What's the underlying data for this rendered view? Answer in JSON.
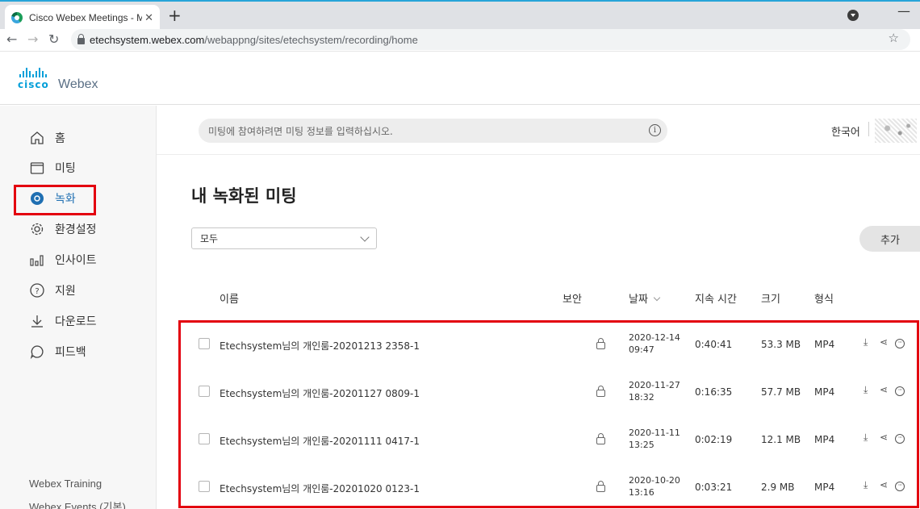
{
  "browser": {
    "tab_title": "Cisco Webex Meetings - My Re",
    "tab_close": "✕",
    "new_tab": "+",
    "window_min": "—",
    "url_host": "etechsystem.webex.com",
    "url_path": "/webappng/sites/etechsystem/recording/home"
  },
  "brand": {
    "cisco": "cisco",
    "webex": "Webex",
    "color": "#049fd9"
  },
  "sidebar": {
    "items": [
      {
        "label": "홈",
        "icon": "home-icon"
      },
      {
        "label": "미팅",
        "icon": "calendar-icon"
      },
      {
        "label": "녹화",
        "icon": "record-icon",
        "active": true
      },
      {
        "label": "환경설정",
        "icon": "gear-icon"
      },
      {
        "label": "인사이트",
        "icon": "insights-icon"
      },
      {
        "label": "지원",
        "icon": "help-icon"
      },
      {
        "label": "다운로드",
        "icon": "download-icon"
      },
      {
        "label": "피드백",
        "icon": "feedback-icon"
      }
    ],
    "footer": [
      "Webex Training",
      "Webex Events (기본)"
    ]
  },
  "search": {
    "placeholder": "미팅에 참여하려면 미팅 정보를 입력하십시오."
  },
  "language": "한국어",
  "page": {
    "title": "내 녹화된 미팅",
    "filter_value": "모두",
    "add_label": "추가"
  },
  "table": {
    "headers": {
      "name": "이름",
      "security": "보안",
      "date": "날짜",
      "duration": "지속 시간",
      "size": "크기",
      "format": "형식"
    },
    "rows": [
      {
        "name": "Etechsystem님의 개인룸-20201213 2358-1",
        "date": "2020-12-14",
        "time": "09:47",
        "duration": "0:40:41",
        "size": "53.3 MB",
        "format": "MP4"
      },
      {
        "name": "Etechsystem님의 개인룸-20201127 0809-1",
        "date": "2020-11-27",
        "time": "18:32",
        "duration": "0:16:35",
        "size": "57.7 MB",
        "format": "MP4"
      },
      {
        "name": "Etechsystem님의 개인룸-20201111 0417-1",
        "date": "2020-11-11",
        "time": "13:25",
        "duration": "0:02:19",
        "size": "12.1 MB",
        "format": "MP4"
      },
      {
        "name": "Etechsystem님의 개인룸-20201020 0123-1",
        "date": "2020-10-20",
        "time": "13:16",
        "duration": "0:03:21",
        "size": "2.9 MB",
        "format": "MP4"
      }
    ]
  },
  "colors": {
    "highlight": "#e3000f",
    "active": "#1f6fb2"
  }
}
